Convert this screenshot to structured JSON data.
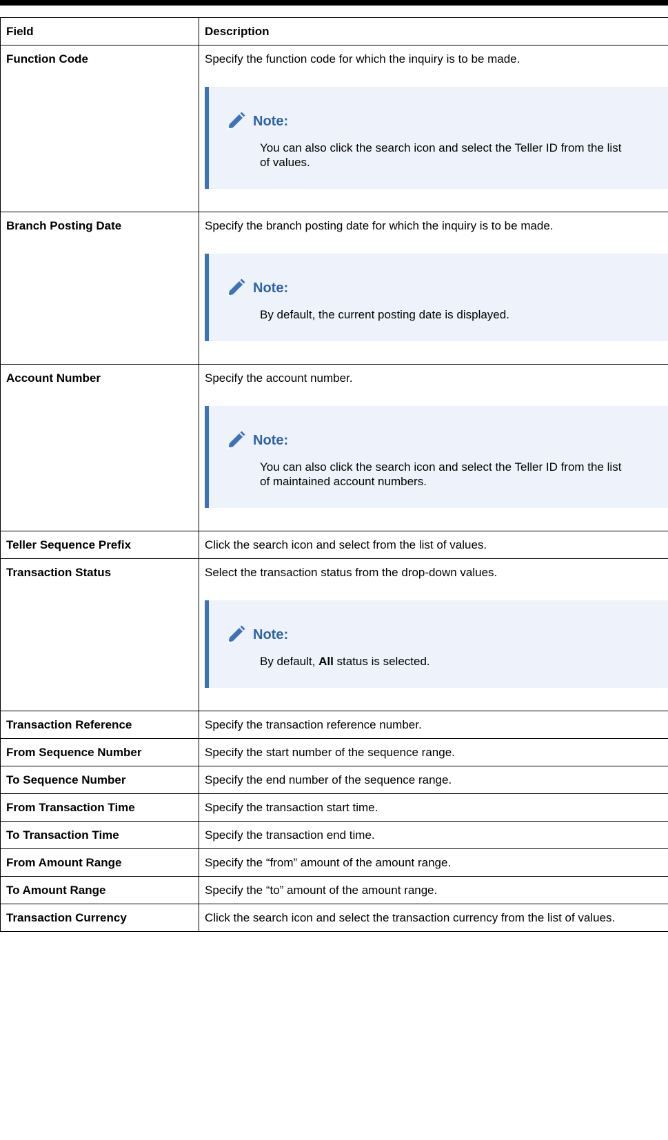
{
  "table": {
    "headers": {
      "field": "Field",
      "description": "Description"
    },
    "rows": [
      {
        "field": "Function Code",
        "description": "Specify the function code for which the inquiry is to be made.",
        "note": {
          "title": "Note:",
          "text": "You can also click the search icon and select the Teller ID from the list of values."
        }
      },
      {
        "field": "Branch Posting Date",
        "description": "Specify the branch posting date for which the inquiry is to be made.",
        "note": {
          "title": "Note:",
          "text": "By default, the current posting date is displayed."
        }
      },
      {
        "field": "Account Number",
        "description": "Specify the account number.",
        "note": {
          "title": "Note:",
          "text": "You can also click the search icon and select the Teller ID from the list of maintained account numbers."
        }
      },
      {
        "field": "Teller Sequence Prefix",
        "description": "Click the search icon and select from the list of values."
      },
      {
        "field": "Transaction Status",
        "description": "Select the transaction status from the drop-down values.",
        "note": {
          "title": "Note:",
          "text_before": "By default, ",
          "text_bold": "All",
          "text_after": " status is selected."
        }
      },
      {
        "field": "Transaction Reference",
        "description": "Specify the transaction reference number."
      },
      {
        "field": "From Sequence Number",
        "description": "Specify the start number of the sequence range."
      },
      {
        "field": "To Sequence Number",
        "description": "Specify the end number of the sequence range."
      },
      {
        "field": "From Transaction Time",
        "description": "Specify the transaction start time."
      },
      {
        "field": "To Transaction Time",
        "description": "Specify the transaction end time."
      },
      {
        "field": "From Amount Range",
        "description": "Specify the “from” amount of the amount range."
      },
      {
        "field": "To Amount Range",
        "description": "Specify the “to” amount of the amount range."
      },
      {
        "field": "Transaction Currency",
        "description": "Click the search icon and select the transaction currency from the list of values."
      }
    ]
  },
  "icons": {
    "note": "pencil-icon"
  },
  "colors": {
    "note_accent": "#3b73b6",
    "note_title": "#2b63a6",
    "note_background": "#eef3fb"
  }
}
